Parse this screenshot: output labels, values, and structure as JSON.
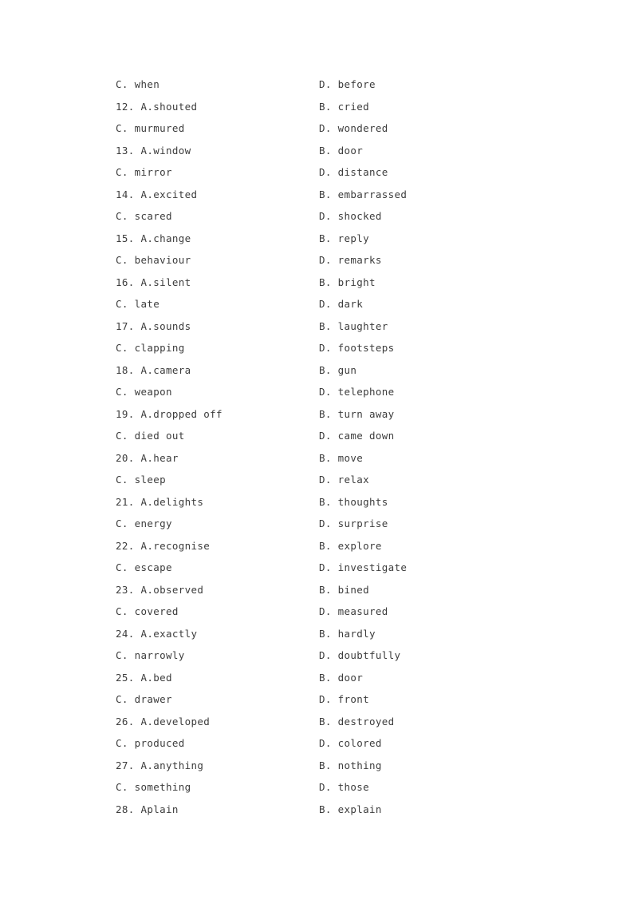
{
  "document": {
    "page_background": "#ffffff",
    "text_color": "#3c3c3c",
    "rows": [
      {
        "left": "C. when",
        "right": "D. before"
      },
      {
        "left": "12. A.shouted",
        "right": "B. cried"
      },
      {
        "left": "C. murmured",
        "right": "D. wondered"
      },
      {
        "left": "13. A.window",
        "right": "B. door"
      },
      {
        "left": "C. mirror",
        "right": "D. distance"
      },
      {
        "left": "14. A.excited",
        "right": "B. embarrassed"
      },
      {
        "left": "C. scared",
        "right": "D. shocked"
      },
      {
        "left": "15. A.change",
        "right": "B. reply"
      },
      {
        "left": "C. behaviour",
        "right": "D. remarks"
      },
      {
        "left": "16. A.silent",
        "right": "B. bright"
      },
      {
        "left": "C. late",
        "right": "D. dark"
      },
      {
        "left": "17. A.sounds",
        "right": "B. laughter"
      },
      {
        "left": "C. clapping",
        "right": "D. footsteps"
      },
      {
        "left": "18. A.camera",
        "right": "B. gun"
      },
      {
        "left": "C. weapon",
        "right": "D. telephone"
      },
      {
        "left": "19. A.dropped off",
        "right": "B. turn away"
      },
      {
        "left": "C. died out",
        "right": "D. came down"
      },
      {
        "left": "20. A.hear",
        "right": "B. move"
      },
      {
        "left": "C. sleep",
        "right": "D. relax"
      },
      {
        "left": "21. A.delights",
        "right": "B. thoughts"
      },
      {
        "left": "C. energy",
        "right": "D. surprise"
      },
      {
        "left": "22. A.recognise",
        "right": "B. explore"
      },
      {
        "left": "C. escape",
        "right": "D. investigate"
      },
      {
        "left": "23. A.observed",
        "right": "B. bined"
      },
      {
        "left": "C. covered",
        "right": "D. measured"
      },
      {
        "left": "24. A.exactly",
        "right": "B. hardly"
      },
      {
        "left": "C. narrowly",
        "right": "D. doubtfully"
      },
      {
        "left": "25. A.bed",
        "right": "B. door"
      },
      {
        "left": "C. drawer",
        "right": "D. front"
      },
      {
        "left": "26. A.developed",
        "right": "B. destroyed"
      },
      {
        "left": "C. produced",
        "right": "D. colored"
      },
      {
        "left": "27. A.anything",
        "right": "B. nothing"
      },
      {
        "left": "C. something",
        "right": "D. those"
      },
      {
        "left": "28. Aplain",
        "right": "B. explain"
      }
    ]
  }
}
